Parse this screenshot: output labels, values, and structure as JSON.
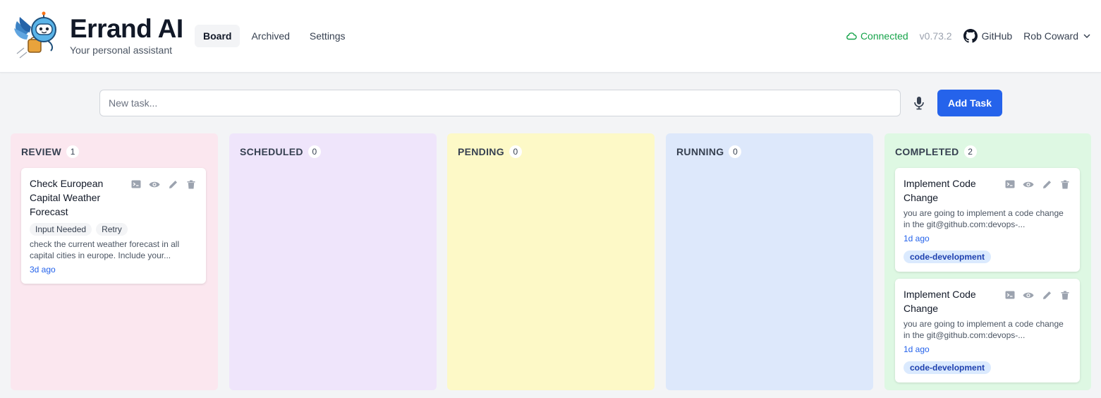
{
  "app": {
    "title": "Errand AI",
    "subtitle": "Your personal assistant"
  },
  "nav": {
    "items": [
      {
        "label": "Board",
        "active": true
      },
      {
        "label": "Archived",
        "active": false
      },
      {
        "label": "Settings",
        "active": false
      }
    ]
  },
  "status": {
    "connection": "Connected",
    "version": "v0.73.2",
    "github": "GitHub",
    "user": "Rob Coward"
  },
  "new_task": {
    "placeholder": "New task...",
    "value": "",
    "add_label": "Add Task"
  },
  "columns": [
    {
      "title": "REVIEW",
      "count": "1",
      "cards": [
        {
          "title": "Check European Capital Weather Forecast",
          "tags": [
            "Input Needed",
            "Retry"
          ],
          "description": "check the current weather forecast in all capital cities in europe. Include your...",
          "time": "3d ago"
        }
      ]
    },
    {
      "title": "SCHEDULED",
      "count": "0",
      "cards": []
    },
    {
      "title": "PENDING",
      "count": "0",
      "cards": []
    },
    {
      "title": "RUNNING",
      "count": "0",
      "cards": []
    },
    {
      "title": "COMPLETED",
      "count": "2",
      "cards": [
        {
          "title": "Implement Code Change",
          "description": "you are going to implement a code change in the git@github.com:devops-...",
          "time": "1d ago",
          "label": "code-development"
        },
        {
          "title": "Implement Code Change",
          "description": "you are going to implement a code change in the git@github.com:devops-...",
          "time": "1d ago",
          "label": "code-development"
        }
      ]
    }
  ],
  "colors": {
    "accent": "#2563eb",
    "connected": "#16a34a",
    "review_bg": "#fbe7ef",
    "scheduled_bg": "#efe5fb",
    "pending_bg": "#fdf9c7",
    "running_bg": "#dde8fb",
    "completed_bg": "#def8e3"
  },
  "icons": {
    "card_actions": [
      "terminal-icon",
      "eye-icon",
      "pencil-icon",
      "trash-icon"
    ]
  }
}
